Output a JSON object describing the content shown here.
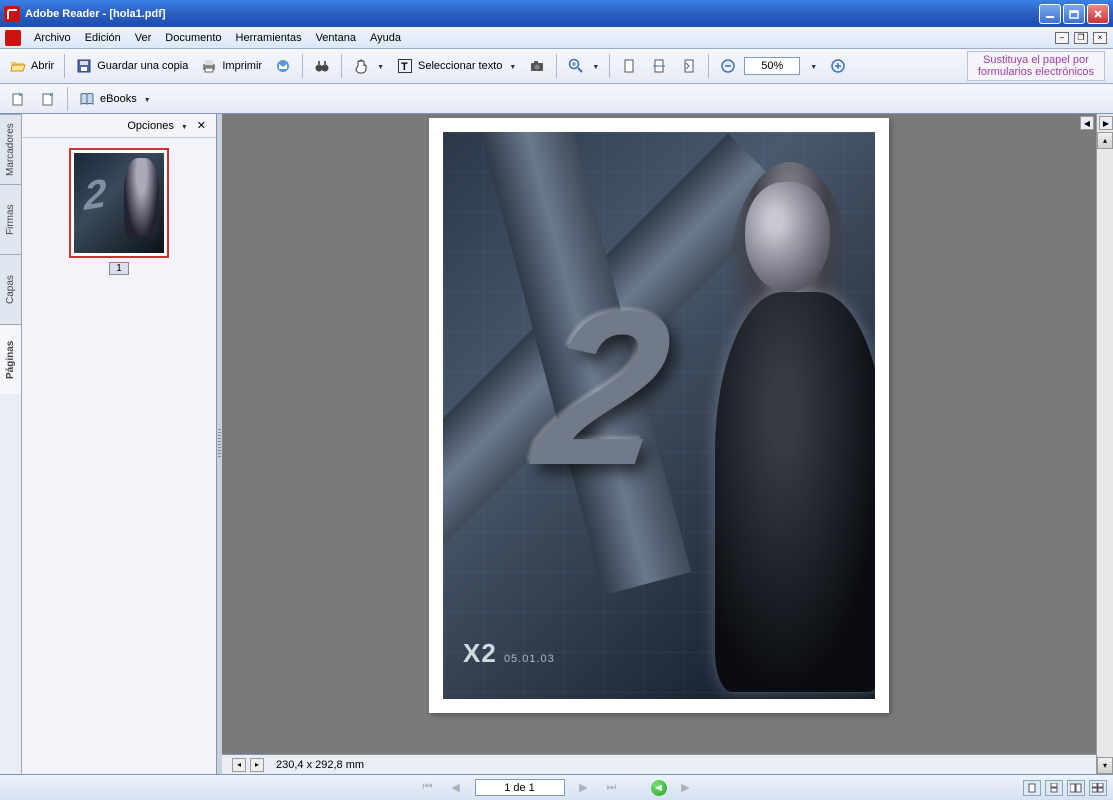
{
  "titlebar": {
    "app": "Adobe Reader",
    "doc": "[hola1.pdf]"
  },
  "menubar": [
    "Archivo",
    "Edición",
    "Ver",
    "Documento",
    "Herramientas",
    "Ventana",
    "Ayuda"
  ],
  "toolbar": {
    "open": "Abrir",
    "save_copy": "Guardar una copia",
    "print": "Imprimir",
    "select_text": "Seleccionar texto",
    "zoom_value": "50%",
    "promo_line1": "Sustituya el papel por",
    "promo_line2": "formularios electrónicos"
  },
  "toolbar2": {
    "ebooks": "eBooks"
  },
  "side_tabs": [
    "Marcadores",
    "Firmas",
    "Capas",
    "Páginas"
  ],
  "active_tab": "Páginas",
  "nav_panel": {
    "options": "Opciones",
    "thumb_page": "1"
  },
  "status_bar": {
    "dimensions": "230,4 x 292,8 mm"
  },
  "nav_bar": {
    "page_indicator": "1 de 1"
  },
  "page_content": {
    "title_logo": "X2",
    "date": "05.01.03"
  }
}
